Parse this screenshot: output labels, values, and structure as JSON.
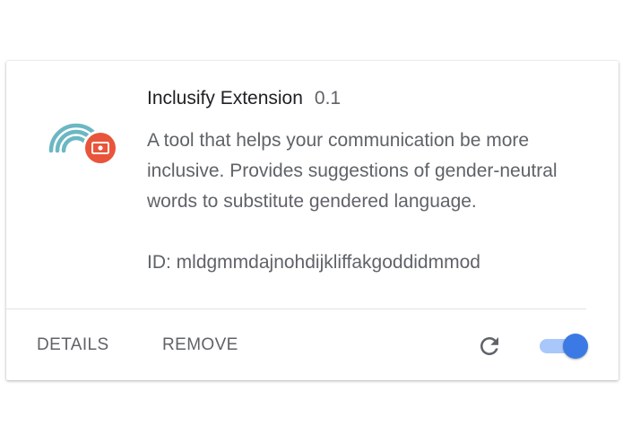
{
  "extension": {
    "name": "Inclusify Extension",
    "version": "0.1",
    "description": "A tool that helps your communication be more inclusive. Provides suggestions of gender-neutral words to substitute gendered language.",
    "id_text": "ID: mldgmmdajnohdijkliffakgoddidmmod",
    "icon": "rainbow-with-badge-icon",
    "enabled": true
  },
  "actions": {
    "details_label": "DETAILS",
    "remove_label": "REMOVE",
    "reload_icon": "reload-icon"
  },
  "colors": {
    "rainbow": "#6bb7c3",
    "badge": "#e8553a",
    "toggle_on": "#3b7ae4",
    "toggle_track": "#a8c7fa"
  }
}
